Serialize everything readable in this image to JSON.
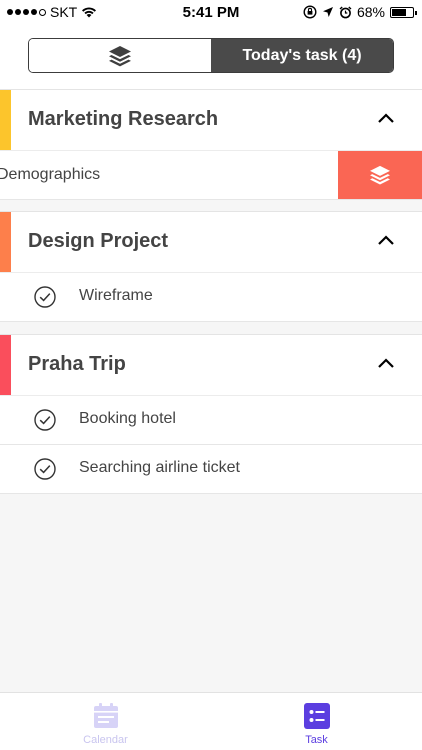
{
  "status_bar": {
    "carrier": "SKT",
    "time": "5:41 PM",
    "battery_percent": "68%",
    "battery_level": 0.68
  },
  "header": {
    "left_segment_icon": "layers-icon",
    "right_segment_label": "Today's task (4)"
  },
  "groups": [
    {
      "title": "Marketing Research",
      "accent_color": "#fcc52c",
      "tasks": [
        {
          "label": "Demographics",
          "swiped": true,
          "action_icon": "layers-icon",
          "action_color": "#fa6654"
        }
      ]
    },
    {
      "title": "Design Project",
      "accent_color": "#fd7f4b",
      "tasks": [
        {
          "label": "Wireframe"
        }
      ]
    },
    {
      "title": "Praha Trip",
      "accent_color": "#fa4e5c",
      "tasks": [
        {
          "label": "Booking hotel"
        },
        {
          "label": "Searching airline ticket"
        }
      ]
    }
  ],
  "tab_bar": {
    "tabs": [
      {
        "label": "Calendar",
        "icon": "calendar-icon",
        "active": false,
        "color": "#d7d3f7"
      },
      {
        "label": "Task",
        "icon": "task-list-icon",
        "active": true,
        "color": "#5b3ee0"
      }
    ]
  }
}
